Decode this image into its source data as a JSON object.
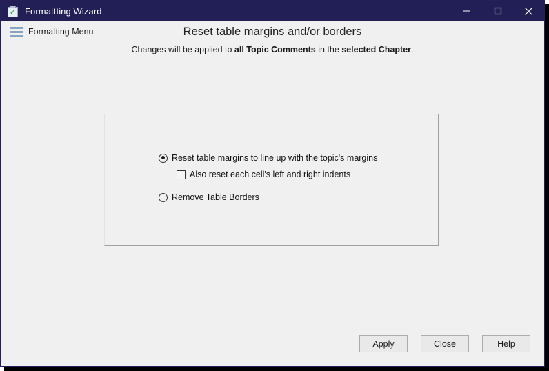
{
  "window": {
    "title": "Formattting Wizard",
    "icon": "clipboard-check-icon",
    "accent_color": "#211f56",
    "background_color": "#f0f0f0",
    "controls": {
      "minimize": "minimize-icon",
      "maximize": "maximize-icon",
      "close": "close-icon"
    }
  },
  "menu": {
    "icon": "hamburger-icon",
    "label": "Formatting Menu"
  },
  "heading": {
    "title": "Reset table margins and/or borders",
    "subtitle_part1": "Changes will be applied to ",
    "subtitle_bold1": "all Topic Comments",
    "subtitle_part2": " in the ",
    "subtitle_bold2": "selected Chapter",
    "subtitle_part3": "."
  },
  "options": {
    "reset_margins": {
      "label": "Reset table margins to line up with the topic's  margins",
      "type": "radio",
      "checked": true
    },
    "cell_indents": {
      "label": "Also reset each cell's left and right indents",
      "type": "checkbox",
      "checked": false
    },
    "remove_borders": {
      "label": "Remove Table Borders",
      "type": "radio",
      "checked": false
    }
  },
  "footer": {
    "apply_label": "Apply",
    "close_label": "Close",
    "help_label": "Help"
  }
}
